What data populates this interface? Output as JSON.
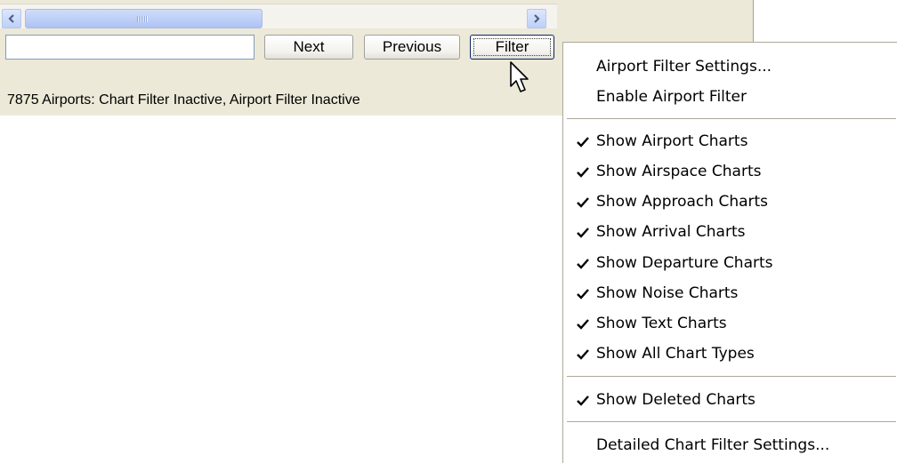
{
  "toolbar": {
    "search_value": "",
    "next_label": "Next",
    "previous_label": "Previous",
    "filter_label": "Filter"
  },
  "status": {
    "text": "7875 Airports: Chart Filter Inactive, Airport Filter Inactive"
  },
  "menu": {
    "items": [
      {
        "label": "Airport Filter Settings...",
        "checked": false
      },
      {
        "label": "Enable Airport Filter",
        "checked": false
      },
      {
        "label": "Show Airport Charts",
        "checked": true
      },
      {
        "label": "Show Airspace Charts",
        "checked": true
      },
      {
        "label": "Show Approach Charts",
        "checked": true
      },
      {
        "label": "Show Arrival Charts",
        "checked": true
      },
      {
        "label": "Show Departure Charts",
        "checked": true
      },
      {
        "label": "Show Noise Charts",
        "checked": true
      },
      {
        "label": "Show Text Charts",
        "checked": true
      },
      {
        "label": "Show All Chart Types",
        "checked": true
      },
      {
        "label": "Show Deleted Charts",
        "checked": true
      },
      {
        "label": "Detailed Chart Filter Settings...",
        "checked": false
      }
    ]
  },
  "icons": {
    "scroll_left": "chevron-left-icon",
    "scroll_right": "chevron-right-icon",
    "check": "checkmark-icon",
    "cursor": "mouse-pointer-icon"
  },
  "colors": {
    "panel_bg": "#ece9d8",
    "scroll_blue": "#bcd0f8",
    "menu_border": "#aca899"
  }
}
